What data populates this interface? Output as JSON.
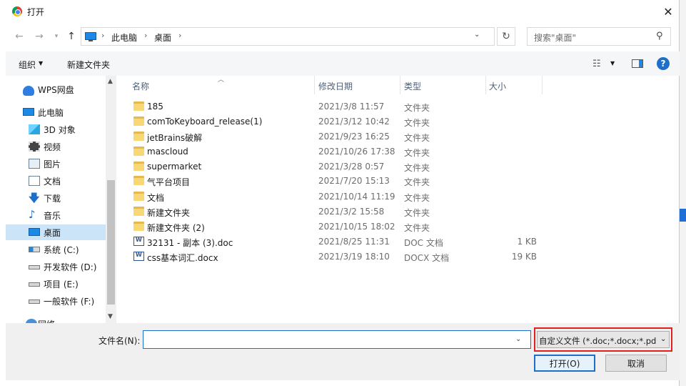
{
  "window": {
    "title": "打开",
    "close_glyph": "✕"
  },
  "nav": {
    "back": "←",
    "forward": "→",
    "up": "↑",
    "refresh": "↻"
  },
  "breadcrumbs": [
    "此电脑",
    "桌面"
  ],
  "search": {
    "placeholder": "搜索\"桌面\""
  },
  "toolbar": {
    "organize": "组织",
    "new_folder": "新建文件夹",
    "help": "?"
  },
  "sidebar": {
    "items": [
      {
        "label": "WPS网盘",
        "icon": "cloud-icon"
      },
      {
        "label": "此电脑",
        "icon": "computer-icon"
      },
      {
        "label": "3D 对象",
        "icon": "cube-icon"
      },
      {
        "label": "视频",
        "icon": "video-icon"
      },
      {
        "label": "图片",
        "icon": "picture-icon"
      },
      {
        "label": "文档",
        "icon": "document-icon"
      },
      {
        "label": "下载",
        "icon": "download-icon"
      },
      {
        "label": "音乐",
        "icon": "music-icon"
      },
      {
        "label": "桌面",
        "icon": "desktop-icon",
        "selected": true
      },
      {
        "label": "系统 (C:)",
        "icon": "windows-drive-icon"
      },
      {
        "label": "开发软件 (D:)",
        "icon": "drive-icon"
      },
      {
        "label": "项目 (E:)",
        "icon": "drive-icon"
      },
      {
        "label": "一般软件 (F:)",
        "icon": "drive-icon"
      },
      {
        "label": "网络",
        "icon": "network-icon"
      }
    ]
  },
  "columns": {
    "name": "名称",
    "modified": "修改日期",
    "type": "类型",
    "size": "大小"
  },
  "files": [
    {
      "name": "185",
      "date": "2021/3/8 11:57",
      "type": "文件夹",
      "size": "",
      "kind": "folder"
    },
    {
      "name": "comToKeyboard_release(1)",
      "date": "2021/3/12 10:42",
      "type": "文件夹",
      "size": "",
      "kind": "folder"
    },
    {
      "name": "jetBrains破解",
      "date": "2021/9/23 16:25",
      "type": "文件夹",
      "size": "",
      "kind": "folder"
    },
    {
      "name": "mascloud",
      "date": "2021/10/26 17:38",
      "type": "文件夹",
      "size": "",
      "kind": "folder"
    },
    {
      "name": "supermarket",
      "date": "2021/3/28 0:57",
      "type": "文件夹",
      "size": "",
      "kind": "folder"
    },
    {
      "name": "气平台项目",
      "date": "2021/7/20 15:13",
      "type": "文件夹",
      "size": "",
      "kind": "folder"
    },
    {
      "name": "文档",
      "date": "2021/10/14 11:19",
      "type": "文件夹",
      "size": "",
      "kind": "folder"
    },
    {
      "name": "新建文件夹",
      "date": "2021/3/2 15:58",
      "type": "文件夹",
      "size": "",
      "kind": "folder"
    },
    {
      "name": "新建文件夹 (2)",
      "date": "2021/10/15 18:02",
      "type": "文件夹",
      "size": "",
      "kind": "folder"
    },
    {
      "name": "32131 - 副本 (3).doc",
      "date": "2021/8/25 11:31",
      "type": "DOC 文档",
      "size": "1 KB",
      "kind": "doc"
    },
    {
      "name": "css基本词汇.docx",
      "date": "2021/3/19 18:10",
      "type": "DOCX 文档",
      "size": "19 KB",
      "kind": "doc"
    }
  ],
  "footer": {
    "filename_label": "文件名(N):",
    "filename_value": "",
    "filter": "自定义文件 (*.doc;*.docx;*.pd",
    "open": "打开(O)",
    "cancel": "取消"
  },
  "colors": {
    "accent": "#1e6fc7",
    "selection": "#cce4f7",
    "highlight_box": "#e02020"
  }
}
